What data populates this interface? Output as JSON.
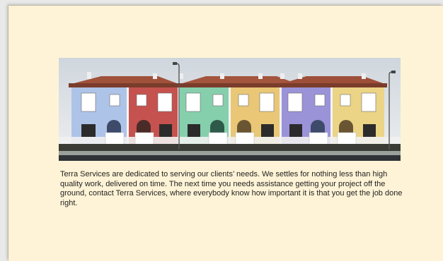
{
  "main": {
    "hero_image": {
      "subject": "row of colorful townhouses",
      "house_colors": [
        "#a9bfe6",
        "#c5524e",
        "#86cfad",
        "#e9c776",
        "#9b93d8",
        "#ecd486"
      ]
    },
    "intro_text": "Terra Services are dedicated to serving our clients’ needs. We settles for nothing less than high quality work, delivered on time. The next time you needs assistance getting your project off the ground, contact Terra Services, where everybody know how important it is that you get the job done right."
  }
}
